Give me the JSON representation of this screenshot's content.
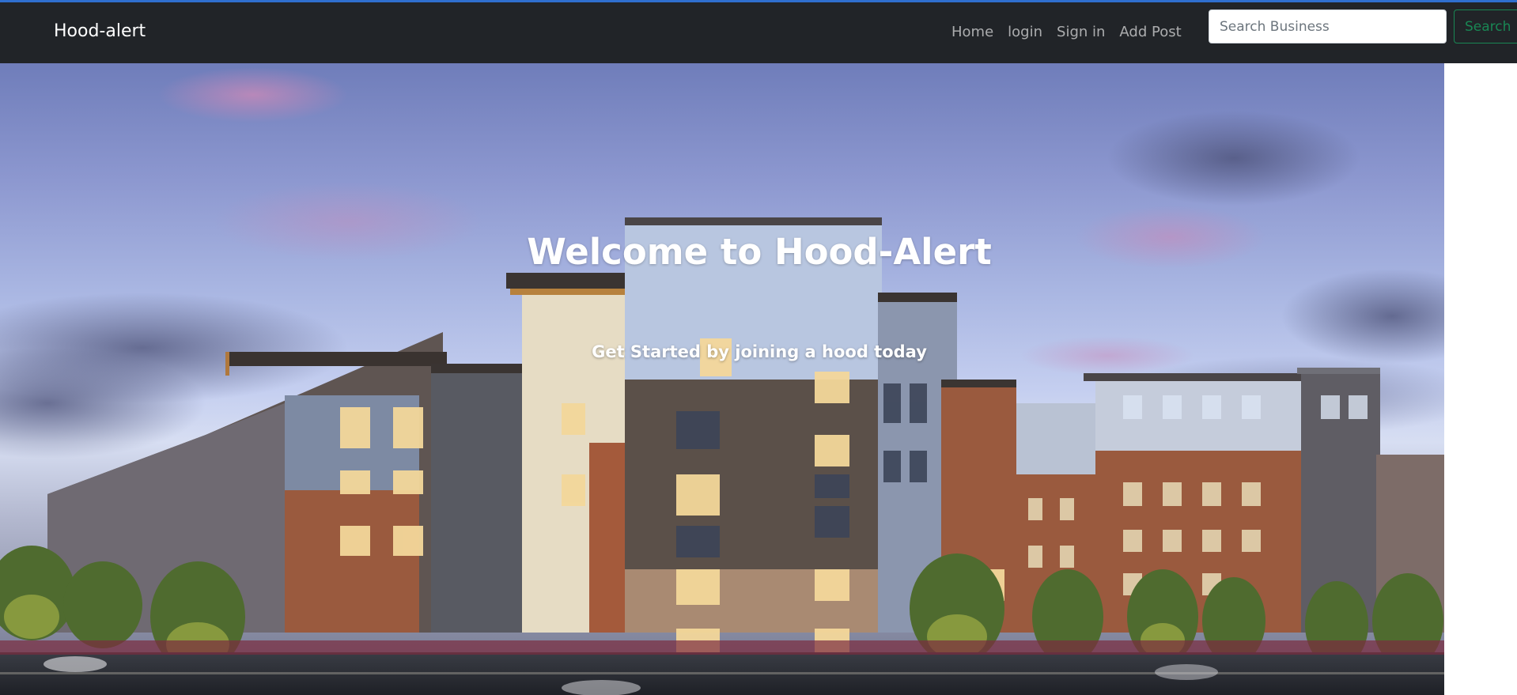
{
  "navbar": {
    "brand": "Hood-alert",
    "links": [
      "Home",
      "login",
      "Sign in",
      "Add Post"
    ],
    "search": {
      "placeholder": "Search Business",
      "value": ""
    },
    "search_button": "Search"
  },
  "hero": {
    "title": "Welcome to Hood-Alert",
    "subtitle": "Get Started by joining a hood today",
    "image": "apartment-complex-dusk-photo"
  },
  "colors": {
    "navbar_bg": "#212428",
    "accent_line": "#2f6fcf",
    "search_button": "#198754"
  }
}
